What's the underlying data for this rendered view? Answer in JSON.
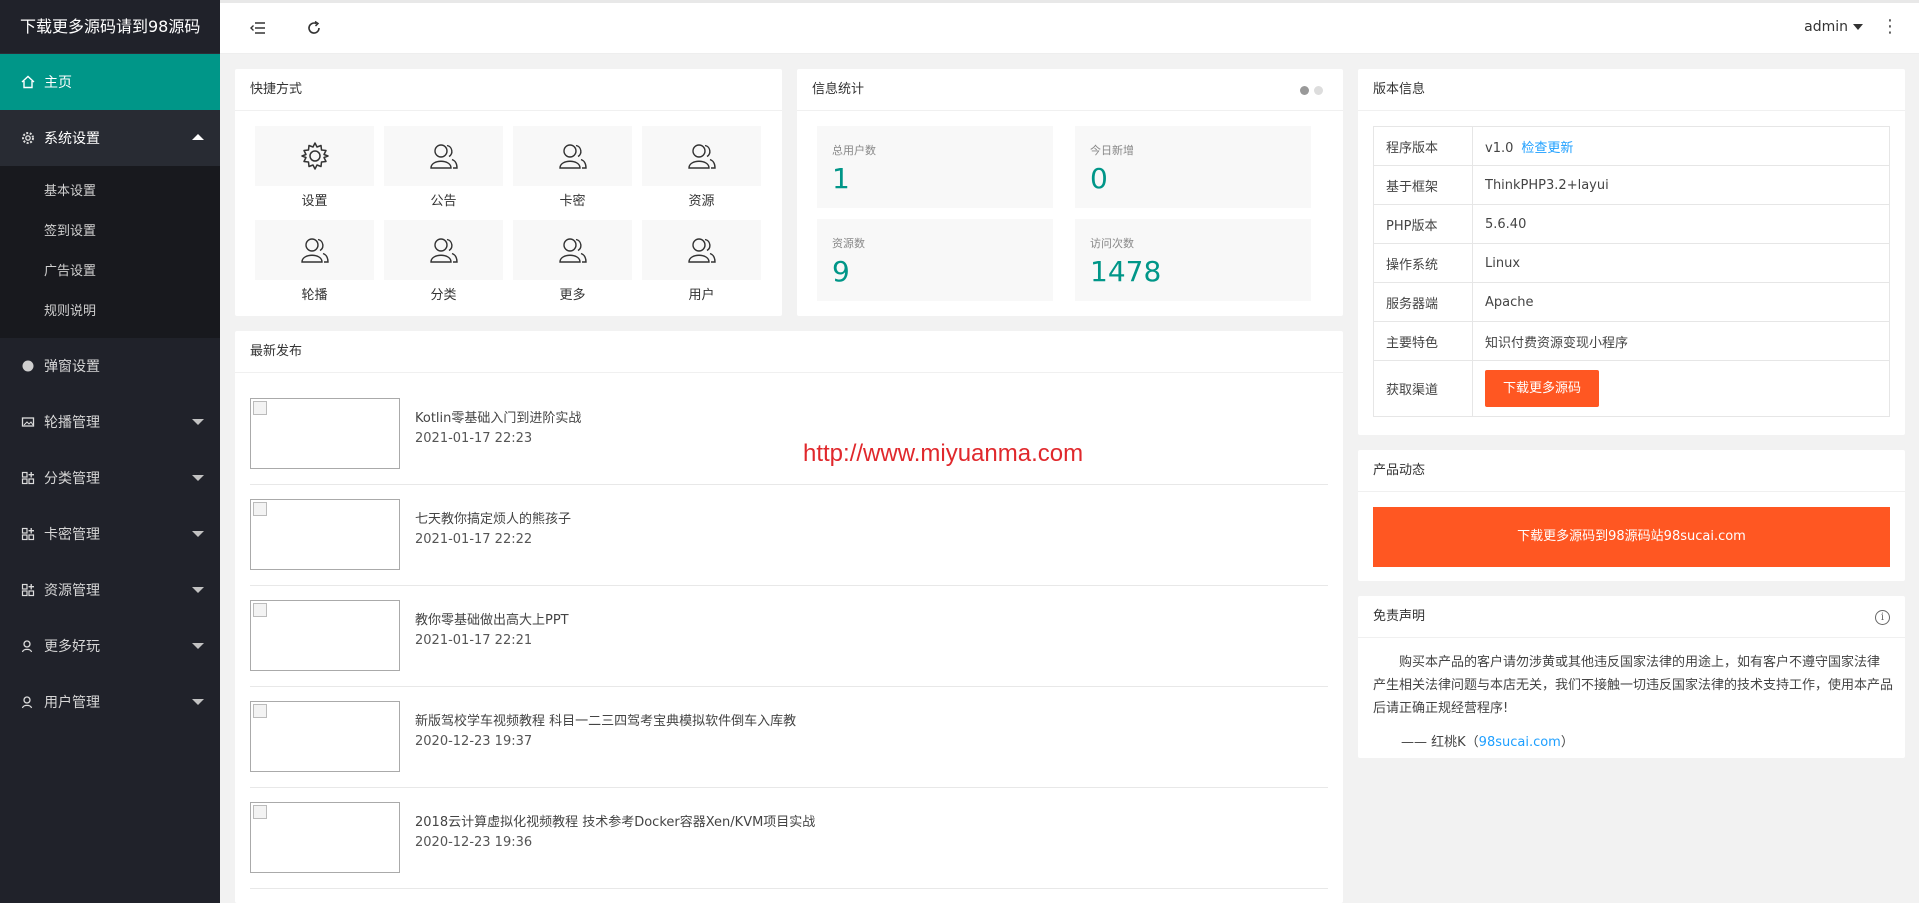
{
  "sidebar": {
    "brand": "下载更多源码请到98源码",
    "home": "主页",
    "system": "系统设置",
    "sub_items": [
      "基本设置",
      "签到设置",
      "广告设置",
      "规则说明"
    ],
    "items": [
      "弹窗设置",
      "轮播管理",
      "分类管理",
      "卡密管理",
      "资源管理",
      "更多好玩",
      "用户管理"
    ]
  },
  "header": {
    "user": "admin",
    "more": "⋮"
  },
  "shortcuts": {
    "title": "快捷方式",
    "items": [
      "设置",
      "公告",
      "卡密",
      "资源",
      "轮播",
      "分类",
      "更多",
      "用户"
    ]
  },
  "stats": {
    "title": "信息统计",
    "items": [
      {
        "label": "总用户数",
        "value": "1"
      },
      {
        "label": "今日新增",
        "value": "0"
      },
      {
        "label": "资源数",
        "value": "9"
      },
      {
        "label": "访问次数",
        "value": "1478"
      }
    ]
  },
  "news": {
    "title": "最新发布",
    "items": [
      {
        "title": "Kotlin零基础入门到进阶实战",
        "time": "2021-01-17 22:23"
      },
      {
        "title": "七天教你搞定烦人的熊孩子",
        "time": "2021-01-17 22:22"
      },
      {
        "title": "教你零基础做出高大上PPT",
        "time": "2021-01-17 22:21"
      },
      {
        "title": "新版驾校学车视频教程 科目一二三四驾考宝典模拟软件倒车入库教",
        "time": "2020-12-23 19:37"
      },
      {
        "title": "2018云计算虚拟化视频教程 技术参考Docker容器Xen/KVM项目实战",
        "time": "2020-12-23 19:36"
      }
    ]
  },
  "watermark": "http://www.miyuanma.com",
  "version": {
    "title": "版本信息",
    "rows": [
      {
        "key": "程序版本",
        "value": "v1.0"
      },
      {
        "key": "基于框架",
        "value": "ThinkPHP3.2+layui"
      },
      {
        "key": "PHP版本",
        "value": "5.6.40"
      },
      {
        "key": "操作系统",
        "value": "Linux"
      },
      {
        "key": "服务器端",
        "value": "Apache"
      },
      {
        "key": "主要特色",
        "value": "知识付费资源变现小程序"
      },
      {
        "key": "获取渠道",
        "value": ""
      }
    ],
    "check_update": "检查更新",
    "download_btn": "下载更多源码"
  },
  "product": {
    "title": "产品动态",
    "banner": "下载更多源码到98源码站98sucai.com"
  },
  "disclaimer": {
    "title": "免责声明",
    "text": "购买本产品的客户请勿涉黄或其他违反国家法律的用途上，如有客户不遵守国家法律 产生相关法律问题与本店无关，我们不接触一切违反国家法律的技术支持工作，使用本产品后请正确正规经营程序!",
    "sign_prefix": "—— 红桃K（",
    "sign_link": "98sucai.com",
    "sign_suffix": "）"
  },
  "colors": {
    "accent": "#009688",
    "orange": "#FF5722",
    "link": "#1E9FFF",
    "sidebar_bg": "#20222a"
  }
}
